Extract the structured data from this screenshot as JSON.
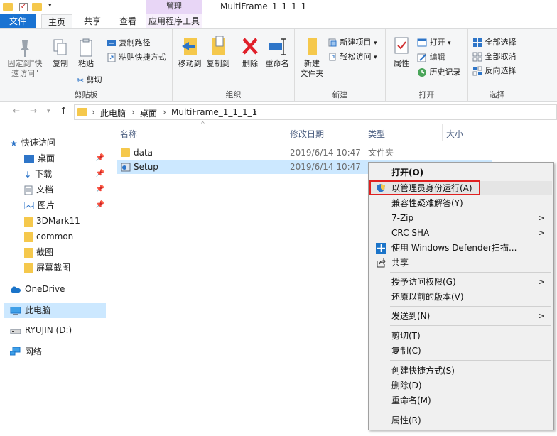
{
  "titlebar": {
    "manage_tab": "管理",
    "window_title": "MultiFrame_1_1_1_1"
  },
  "tabs": {
    "file": "文件",
    "home": "主页",
    "share": "共享",
    "view": "查看",
    "app_tools": "应用程序工具"
  },
  "ribbon": {
    "clipboard": {
      "label": "剪贴板",
      "pin_quick_access": "固定到\"快\n速访问\"",
      "copy": "复制",
      "paste": "粘贴",
      "copy_path": "复制路径",
      "paste_shortcut": "粘贴快捷方式",
      "cut": "剪切"
    },
    "organize": {
      "label": "组织",
      "move_to": "移动到",
      "copy_to": "复制到",
      "delete": "删除",
      "rename": "重命名"
    },
    "new": {
      "label": "新建",
      "new_folder": "新建\n文件夹",
      "new_item": "新建项目",
      "easy_access": "轻松访问"
    },
    "open": {
      "label": "打开",
      "properties": "属性",
      "open": "打开",
      "edit": "编辑",
      "history": "历史记录"
    },
    "select": {
      "label": "选择",
      "select_all": "全部选择",
      "select_none": "全部取消",
      "invert": "反向选择"
    }
  },
  "address": {
    "crumbs": [
      "此电脑",
      "桌面",
      "MultiFrame_1_1_1_1"
    ]
  },
  "nav": {
    "quick_access": "快速访问",
    "items": [
      {
        "label": "桌面",
        "pinned": true
      },
      {
        "label": "下载",
        "pinned": true
      },
      {
        "label": "文档",
        "pinned": true
      },
      {
        "label": "图片",
        "pinned": true
      },
      {
        "label": "3DMark11",
        "pinned": false
      },
      {
        "label": "common",
        "pinned": false
      },
      {
        "label": "截图",
        "pinned": false
      },
      {
        "label": "屏幕截图",
        "pinned": false
      }
    ],
    "onedrive": "OneDrive",
    "this_pc": "此电脑",
    "drive": "RYUJIN (D:)",
    "network": "网络"
  },
  "filelist": {
    "columns": {
      "name": "名称",
      "modified": "修改日期",
      "type": "类型",
      "size": "大小"
    },
    "rows": [
      {
        "name": "data",
        "modified": "2019/6/14 10:47",
        "type": "文件夹"
      },
      {
        "name": "Setup",
        "modified": "2019/6/14 10:47",
        "type": ""
      }
    ]
  },
  "context_menu": {
    "open": "打开(O)",
    "run_as_admin": "以管理员身份运行(A)",
    "compat": "兼容性疑难解答(Y)",
    "zip": "7-Zip",
    "crc": "CRC SHA",
    "defender": "使用 Windows Defender扫描...",
    "share": "共享",
    "grant_access": "授予访问权限(G)",
    "restore": "还原以前的版本(V)",
    "send_to": "发送到(N)",
    "cut": "剪切(T)",
    "copy": "复制(C)",
    "create_shortcut": "创建快捷方式(S)",
    "delete": "删除(D)",
    "rename": "重命名(M)",
    "properties": "属性(R)"
  },
  "colors": {
    "file_tab": "#1a73d2",
    "selection": "#cce8ff",
    "highlight_box": "#e02020",
    "manage_tab": "#e8d6f6"
  }
}
